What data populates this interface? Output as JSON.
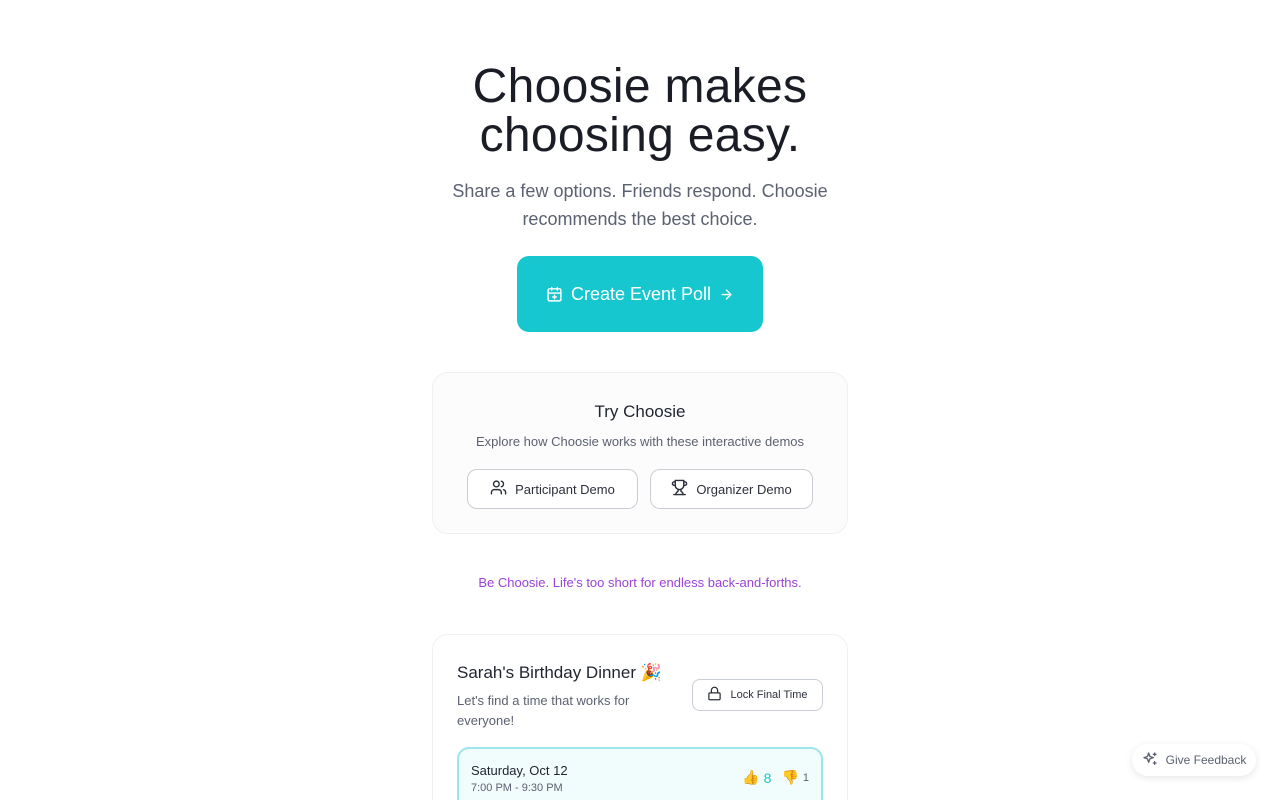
{
  "hero": {
    "title": "Choosie makes choosing easy.",
    "subtitle": "Share a few options. Friends respond. Choosie recommends the best choice.",
    "cta_label": "Create Event Poll",
    "cta_color": "#17c7cf"
  },
  "try_section": {
    "title": "Try Choosie",
    "description": "Explore how Choosie works with these interactive demos",
    "participant_label": "Participant Demo",
    "organizer_label": "Organizer Demo"
  },
  "tagline": "Be Choosie. Life's too short for endless back-and-forths.",
  "event": {
    "title": "Sarah's Birthday Dinner 🎉",
    "description": "Let's find a time that works for everyone!",
    "lock_label": "Lock Final Time",
    "option": {
      "date": "Saturday, Oct 12",
      "time": "7:00 PM - 9:30 PM",
      "up_emoji": "👍",
      "up_votes": "8",
      "down_emoji": "👎",
      "down_votes": "1"
    }
  },
  "feedback_label": "Give Feedback",
  "icons": {
    "cta": "calendar-icon",
    "cta_arrow": "arrow-right-icon",
    "participant": "users-icon",
    "organizer": "trophy-icon",
    "lock": "lock-icon",
    "feedback": "sparkles-icon"
  }
}
